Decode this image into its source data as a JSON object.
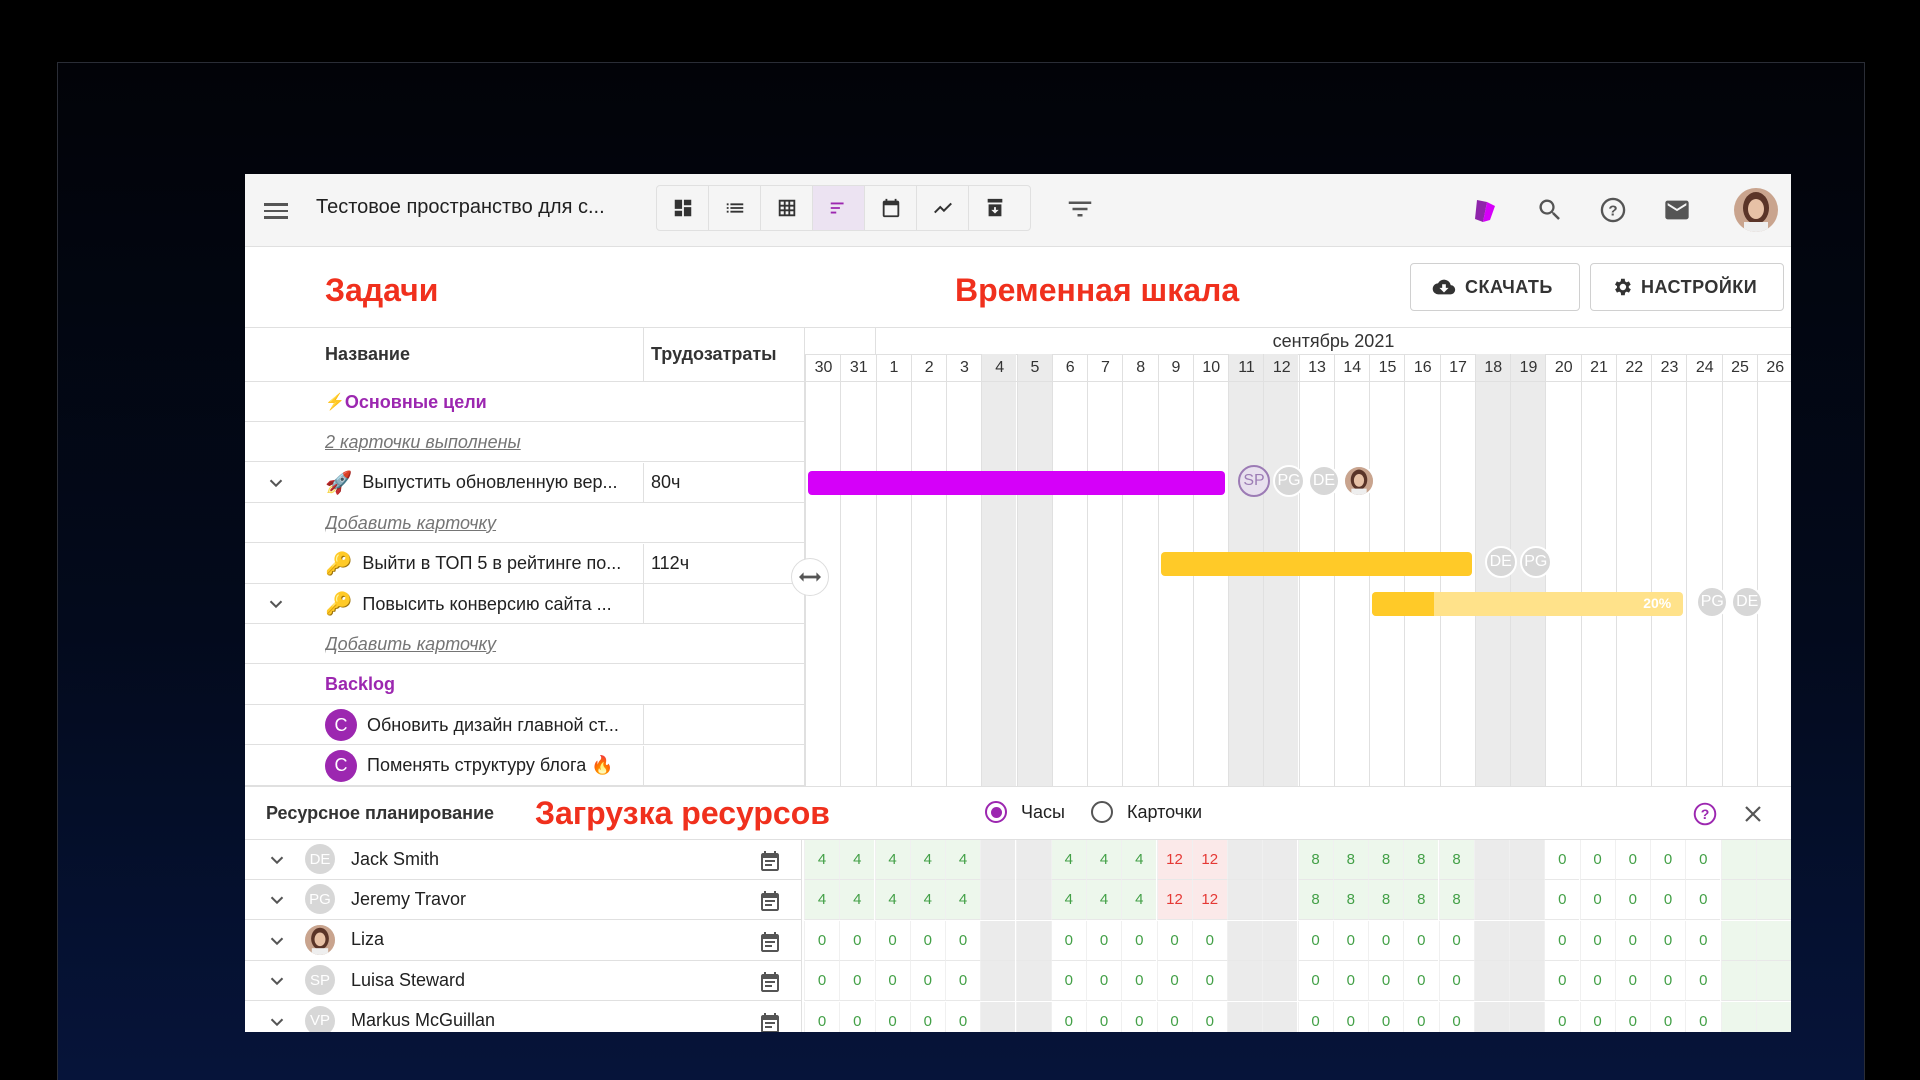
{
  "app": {
    "space_title": "Тестовое пространство для с..."
  },
  "toolbar": {
    "views": [
      "board-view-icon",
      "list-view-icon",
      "table-view-icon",
      "gantt-view-icon",
      "calendar-view-icon",
      "report-view-icon",
      "archive-view-icon"
    ],
    "active_view": "gantt-view-icon",
    "download_label": "СКАЧАТЬ",
    "settings_label": "НАСТРОЙКИ"
  },
  "annotations": {
    "tasks": "Задачи",
    "timeline": "Временная шкала",
    "resources": "Загрузка ресурсов"
  },
  "table": {
    "col_name": "Название",
    "col_effort": "Трудозатраты",
    "rows": [
      {
        "type": "group",
        "icon": "⚡",
        "name": "Основные цели",
        "effort": ""
      },
      {
        "type": "link",
        "name": "2 карточки выполнены",
        "effort": ""
      },
      {
        "type": "task",
        "expand": true,
        "icon": "🚀",
        "name": "Выпустить обновленную вер...",
        "effort": "80ч"
      },
      {
        "type": "link",
        "name": "Добавить карточку",
        "effort": ""
      },
      {
        "type": "task",
        "expand": false,
        "icon": "🔑",
        "name": "Выйти в ТОП 5 в рейтинге по...",
        "effort": "112ч"
      },
      {
        "type": "task",
        "expand": true,
        "icon": "🔑",
        "name": "Повысить конверсию сайта ...",
        "effort": ""
      },
      {
        "type": "link",
        "name": "Добавить карточку",
        "effort": ""
      },
      {
        "type": "group",
        "icon": "",
        "name": "Backlog",
        "effort": ""
      },
      {
        "type": "task",
        "expand": false,
        "badge": "C",
        "name": "Обновить дизайн главной ст...",
        "effort": ""
      },
      {
        "type": "task",
        "expand": false,
        "badge": "C",
        "name": "Поменять структуру блога 🔥",
        "effort": ""
      }
    ]
  },
  "timeline": {
    "month": "сентябрь 2021",
    "days": [
      "30",
      "31",
      "1",
      "2",
      "3",
      "4",
      "5",
      "6",
      "7",
      "8",
      "9",
      "10",
      "11",
      "12",
      "13",
      "14",
      "15",
      "16",
      "17",
      "18",
      "19",
      "20",
      "21",
      "22",
      "23",
      "24",
      "25",
      "26"
    ],
    "weekend_index": [
      5,
      6,
      12,
      13,
      19,
      20
    ],
    "bars": [
      {
        "row": 2,
        "start": 0,
        "end": 12,
        "color": "#d500f9",
        "avatars": [
          "SP",
          "PG",
          "DE",
          "photo"
        ]
      },
      {
        "row": 4,
        "start": 10,
        "end": 19,
        "color": "#ffca28",
        "avatars": [
          "DE",
          "PG"
        ]
      },
      {
        "row": 5,
        "start": 16,
        "end": 25,
        "color": "#ffca28",
        "progress": 20,
        "progress_label": "20%",
        "avatars": [
          "PG",
          "DE"
        ]
      }
    ]
  },
  "resources": {
    "title": "Ресурсное планирование",
    "mode_hours": "Часы",
    "mode_cards": "Карточки",
    "people": [
      {
        "initials": "DE",
        "name": "Jack Smith",
        "load": [
          "4",
          "4",
          "4",
          "4",
          "4",
          "",
          "",
          "4",
          "4",
          "4",
          "12",
          "12",
          "",
          "",
          "8",
          "8",
          "8",
          "8",
          "8",
          "",
          "",
          "0",
          "0",
          "0",
          "0",
          "0",
          "",
          ""
        ]
      },
      {
        "initials": "PG",
        "name": "Jeremy Travor",
        "load": [
          "4",
          "4",
          "4",
          "4",
          "4",
          "",
          "",
          "4",
          "4",
          "4",
          "12",
          "12",
          "",
          "",
          "8",
          "8",
          "8",
          "8",
          "8",
          "",
          "",
          "0",
          "0",
          "0",
          "0",
          "0",
          "",
          ""
        ]
      },
      {
        "initials": "",
        "name": "Liza",
        "photo": true,
        "load": [
          "0",
          "0",
          "0",
          "0",
          "0",
          "",
          "",
          "0",
          "0",
          "0",
          "0",
          "0",
          "",
          "",
          "0",
          "0",
          "0",
          "0",
          "0",
          "",
          "",
          "0",
          "0",
          "0",
          "0",
          "0",
          "",
          ""
        ]
      },
      {
        "initials": "SP",
        "name": "Luisa Steward",
        "load": [
          "0",
          "0",
          "0",
          "0",
          "0",
          "",
          "",
          "0",
          "0",
          "0",
          "0",
          "0",
          "",
          "",
          "0",
          "0",
          "0",
          "0",
          "0",
          "",
          "",
          "0",
          "0",
          "0",
          "0",
          "0",
          "",
          ""
        ]
      },
      {
        "initials": "VP",
        "name": "Markus McGuillan",
        "load": [
          "0",
          "0",
          "0",
          "0",
          "0",
          "",
          "",
          "0",
          "0",
          "0",
          "0",
          "0",
          "",
          "",
          "0",
          "0",
          "0",
          "0",
          "0",
          "",
          "",
          "0",
          "0",
          "0",
          "0",
          "0",
          "",
          ""
        ]
      }
    ]
  }
}
